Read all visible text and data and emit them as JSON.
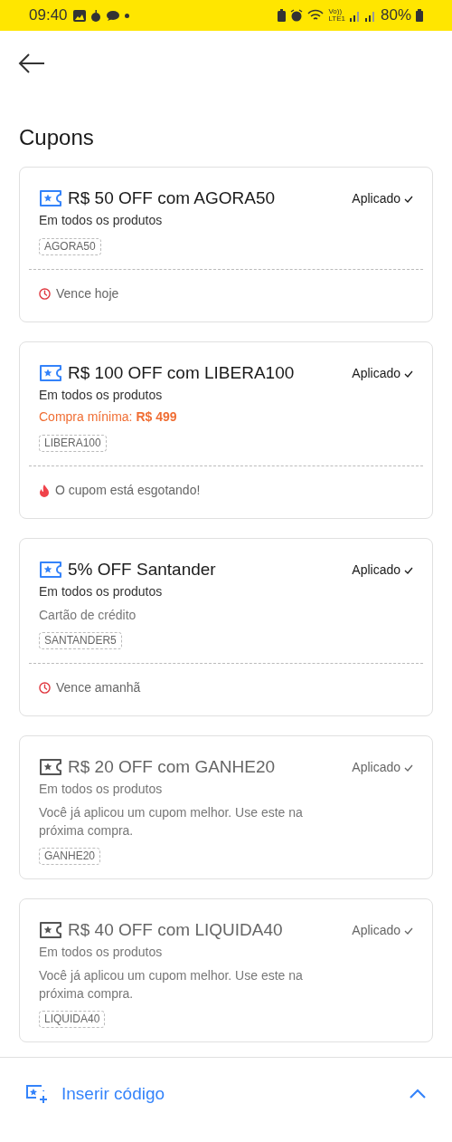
{
  "status_bar": {
    "time": "09:40",
    "network_top": "Vo))",
    "network_bottom": "LTE1",
    "battery": "80%"
  },
  "title": "Cupons",
  "coupons": [
    {
      "title": "R$ 50 OFF com AGORA50",
      "status": "Aplicado",
      "disabled": false,
      "subtitle": "Em todos os produtos",
      "code": "AGORA50",
      "footer": {
        "kind": "clock",
        "text": "Vence hoje"
      }
    },
    {
      "title": "R$ 100 OFF com LIBERA100",
      "status": "Aplicado",
      "disabled": false,
      "subtitle": "Em todos os produtos",
      "minimum": {
        "label": "Compra mínima:",
        "value": "R$ 499"
      },
      "code": "LIBERA100",
      "footer": {
        "kind": "fire",
        "text": "O cupom está esgotando!"
      }
    },
    {
      "title": "5% OFF Santander",
      "status": "Aplicado",
      "disabled": false,
      "subtitle": "Em todos os produtos",
      "note": "Cartão de crédito",
      "code": "SANTANDER5",
      "footer": {
        "kind": "clock",
        "text": "Vence amanhã"
      }
    },
    {
      "title": "R$ 20 OFF com GANHE20",
      "status": "Aplicado",
      "disabled": true,
      "subtitle": "Em todos os produtos",
      "note": "Você já aplicou um cupom melhor. Use este na próxima compra.",
      "code": "GANHE20"
    },
    {
      "title": "R$ 40 OFF com LIQUIDA40",
      "status": "Aplicado",
      "disabled": true,
      "subtitle": "Em todos os produtos",
      "note": "Você já aplicou um cupom melhor. Use este na próxima compra.",
      "code": "LIQUIDA40"
    }
  ],
  "footer_action": {
    "label": "Inserir código",
    "expanded": false
  }
}
